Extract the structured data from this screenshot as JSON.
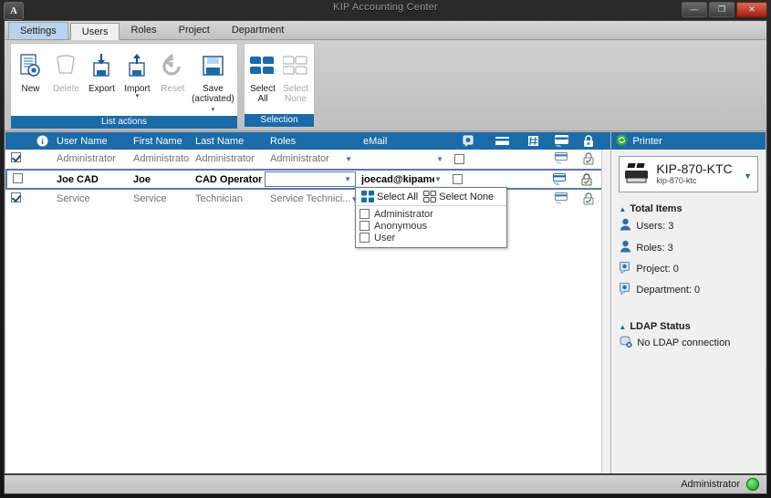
{
  "window": {
    "title": "KIP Accounting Center",
    "app_icon": "A",
    "minimize_label": "—",
    "maximize_label": "❐",
    "close_label": "✕"
  },
  "tabs": [
    {
      "label": "Settings",
      "state": "highlighted"
    },
    {
      "label": "Users",
      "state": "active"
    },
    {
      "label": "Roles",
      "state": "normal"
    },
    {
      "label": "Project",
      "state": "normal"
    },
    {
      "label": "Department",
      "state": "normal"
    }
  ],
  "ribbon": {
    "groups": [
      {
        "caption": "List actions",
        "buttons": [
          {
            "label": "New",
            "icon": "new-document-icon",
            "enabled": true,
            "dropdown": false
          },
          {
            "label": "Delete",
            "icon": "trash-bin-icon",
            "enabled": false,
            "dropdown": false
          },
          {
            "label": "Export",
            "icon": "export-disk-icon",
            "enabled": true,
            "dropdown": false
          },
          {
            "label": "Import",
            "icon": "import-disk-icon",
            "enabled": true,
            "dropdown": true
          },
          {
            "label": "Reset",
            "icon": "reset-arrow-icon",
            "enabled": false,
            "dropdown": false
          },
          {
            "label": "Save (activated)",
            "icon": "floppy-save-icon",
            "enabled": true,
            "dropdown": true
          }
        ]
      },
      {
        "caption": "Selection",
        "buttons": [
          {
            "label": "Select All",
            "icon": "select-all-icon",
            "enabled": true,
            "dropdown": false
          },
          {
            "label": "Select None",
            "icon": "select-none-icon",
            "enabled": false,
            "dropdown": false
          }
        ]
      }
    ]
  },
  "grid": {
    "columns": [
      {
        "label": "",
        "name": "checkbox-column"
      },
      {
        "label": "",
        "name": "info-column",
        "icon": "info-icon"
      },
      {
        "label": "User Name",
        "name": "user-name-column"
      },
      {
        "label": "First Name",
        "name": "first-name-column"
      },
      {
        "label": "Last Name",
        "name": "last-name-column"
      },
      {
        "label": "Roles",
        "name": "roles-column"
      },
      {
        "label": "eMail",
        "name": "email-column"
      },
      {
        "label": "",
        "name": "chat-column",
        "icon": "chat-bubble-icon"
      },
      {
        "label": "",
        "name": "card-column",
        "icon": "card-icon"
      },
      {
        "label": "",
        "name": "grid-column",
        "icon": "grid-icon"
      },
      {
        "label": "",
        "name": "print-column",
        "icon": "print-card-icon"
      },
      {
        "label": "",
        "name": "lock-column",
        "icon": "lock-icon"
      }
    ],
    "rows": [
      {
        "selected_checkbox": true,
        "user_name": "Administrator",
        "first_name": "Administrator",
        "last_name": "Administrator",
        "roles": "Administrator",
        "email": "",
        "flag_checkbox": false,
        "row_state": "normal"
      },
      {
        "selected_checkbox": false,
        "user_name": "Joe CAD",
        "first_name": "Joe",
        "last_name": "CAD Operator",
        "roles": "",
        "email": "joecad@kipamerica",
        "flag_checkbox": false,
        "row_state": "editing"
      },
      {
        "selected_checkbox": true,
        "user_name": "Service",
        "first_name": "Service",
        "last_name": "Technician",
        "roles": "Service Technici...",
        "email": "",
        "flag_checkbox": false,
        "row_state": "normal"
      }
    ]
  },
  "roles_popup": {
    "select_all_label": "Select All",
    "select_none_label": "Select None",
    "options": [
      {
        "label": "Administrator",
        "checked": false
      },
      {
        "label": "Anonymous",
        "checked": false
      },
      {
        "label": "User",
        "checked": false
      }
    ]
  },
  "right_panel": {
    "header": "Printer",
    "header_icon": "printer-status-icon",
    "printer": {
      "name": "KIP-870-KTC",
      "host": "kip-870-ktc",
      "icon": "printer-icon"
    },
    "total_items": {
      "title": "Total Items",
      "stats": [
        {
          "label": "Users: 3",
          "icon": "user-icon"
        },
        {
          "label": "Roles: 3",
          "icon": "user-icon"
        },
        {
          "label": "Project: 0",
          "icon": "project-icon"
        },
        {
          "label": "Department: 0",
          "icon": "department-icon"
        }
      ]
    },
    "ldap": {
      "title": "LDAP Status",
      "status": "No LDAP connection",
      "icon": "database-error-icon"
    }
  },
  "statusbar": {
    "user": "Administrator",
    "led_color": "#22aa22"
  }
}
